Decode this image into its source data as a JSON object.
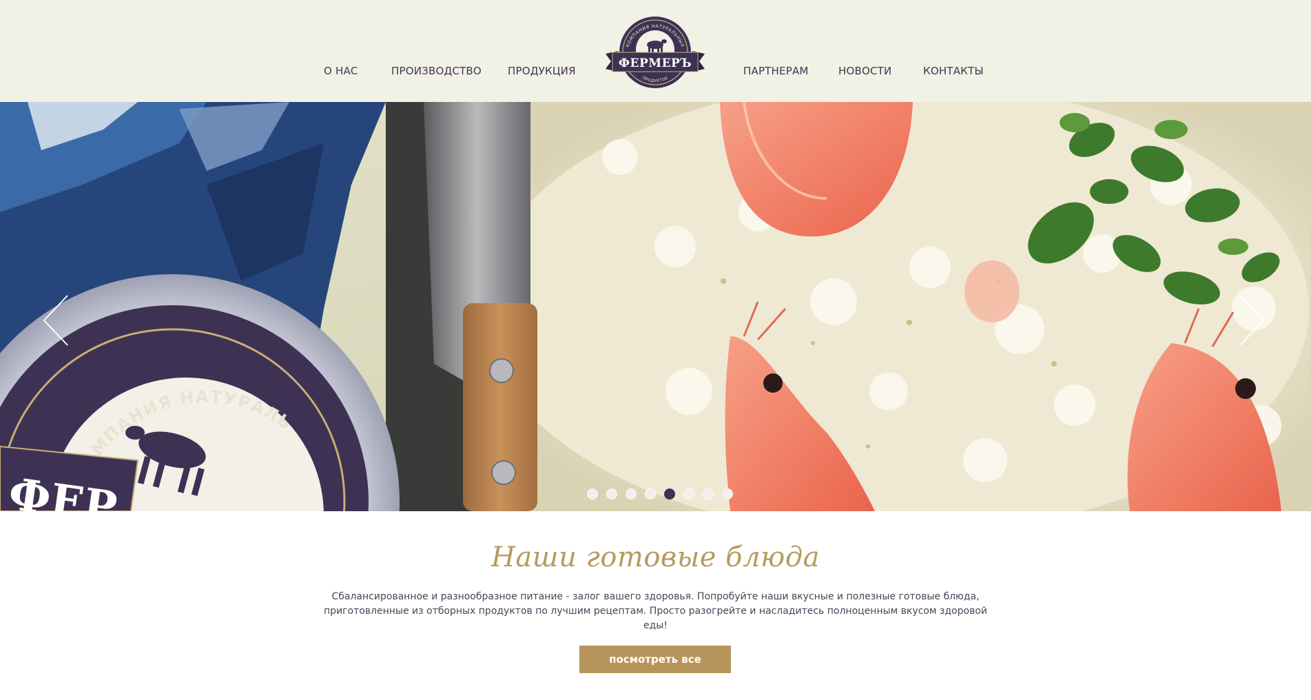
{
  "nav": {
    "left": [
      "О НАС",
      "ПРОИЗВОДСТВО",
      "ПРОДУКЦИЯ"
    ],
    "right": [
      "ПАРТНЕРАМ",
      "НОВОСТИ",
      "КОНТАКТЫ"
    ]
  },
  "logo": {
    "brand": "ФЕРМЕРЪ",
    "arc_top": "КОМПАНИЯ НАТУРАЛЬНЫХ",
    "arc_bottom": "ПРОДУКТОВ"
  },
  "slider": {
    "slide_count": 8,
    "active_index": 4,
    "product_label_arc": "КОМПАНИЯ НАТУРАЛЬНЫХ",
    "product_label_brand": "ФЕР"
  },
  "section": {
    "title": "Наши готовые блюда",
    "desc_line1": "Сбалансированное и разнообразное питание - залог вашего здоровья. Попробуйте наши вкусные и полезные готовые блюда,",
    "desc_line2": "приготовленные из отборных продуктов по лучшим рецептам. Просто разогрейте и насладитесь полноценным вкусом здоровой еды!",
    "button": "посмотреть все"
  },
  "colors": {
    "header_bg": "#f2f1e6",
    "brand_purple": "#3d3254",
    "gold": "#b7955a"
  },
  "icons": {
    "prev": "chevron-left-icon",
    "next": "chevron-right-icon",
    "logo_animal": "cow-icon"
  }
}
